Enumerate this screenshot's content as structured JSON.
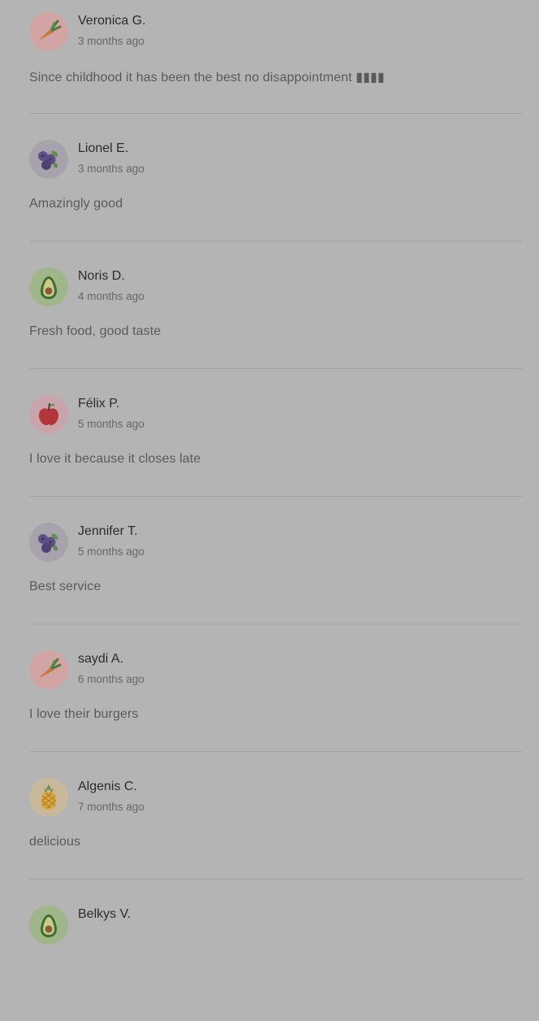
{
  "reviews": [
    {
      "name": "Veronica G.",
      "time": "3 months ago",
      "text": "Since childhood it has been the best no disappointment ▮▮▮▮",
      "avatar_icon": "carrot-icon",
      "avatar_bg": "#d2a4a4"
    },
    {
      "name": "Lionel E.",
      "time": "3 months ago",
      "text": "Amazingly good",
      "avatar_icon": "blueberry-icon",
      "avatar_bg": "#a6a3ad"
    },
    {
      "name": "Noris D.",
      "time": "4 months ago",
      "text": "Fresh food, good taste",
      "avatar_icon": "avocado-icon",
      "avatar_bg": "#9fb58a"
    },
    {
      "name": "Félix P.",
      "time": "5 months ago",
      "text": "I love it because it closes late",
      "avatar_icon": "apple-icon",
      "avatar_bg": "#c9a5ab"
    },
    {
      "name": "Jennifer T.",
      "time": "5 months ago",
      "text": "Best service",
      "avatar_icon": "blueberry-icon",
      "avatar_bg": "#a6a3ad"
    },
    {
      "name": "saydi A.",
      "time": "6 months ago",
      "text": "I love their burgers",
      "avatar_icon": "carrot-icon",
      "avatar_bg": "#d2a4a4"
    },
    {
      "name": "Algenis C.",
      "time": "7 months ago",
      "text": "delicious",
      "avatar_icon": "pineapple-icon",
      "avatar_bg": "#c9b99a"
    },
    {
      "name": "Belkys V.",
      "time": "",
      "text": "",
      "avatar_icon": "avocado-icon",
      "avatar_bg": "#9fb58a"
    }
  ]
}
